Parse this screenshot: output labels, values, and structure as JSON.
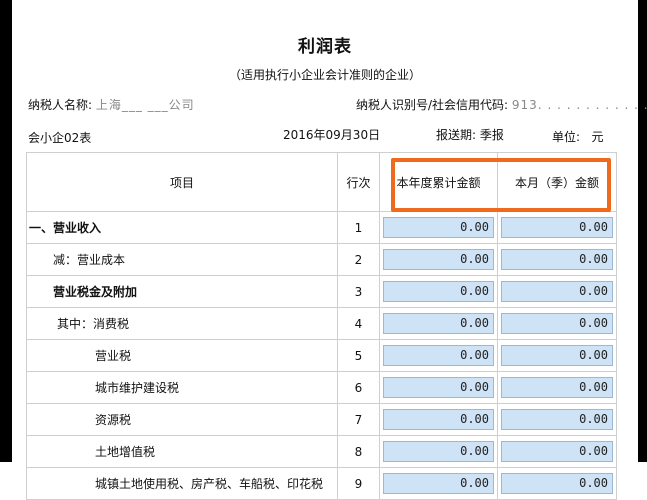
{
  "title": "利润表",
  "subtitle": "（适用执行小企业会计准则的企业）",
  "taxpayer": {
    "name_label": "纳税人名称: ",
    "name_value": "上海___ ___公司",
    "id_label": "纳税人识别号/社会信用代码: ",
    "id_value": "913. . . . . . . . . . . . . . ."
  },
  "form_code": "会小企02表",
  "report_date": "2016年09月30日",
  "period_label": "报送期: ",
  "period_value": "季报",
  "unit_label": "单位:",
  "unit_value": "元",
  "table": {
    "headers": {
      "item": "项目",
      "line": "行次",
      "ytd": "本年度累计金额",
      "period": "本月（季）金额"
    },
    "rows": [
      {
        "item": "一、营业收入",
        "line": "1",
        "ytd": "0.00",
        "period": "0.00"
      },
      {
        "item": "减：营业成本",
        "line": "2",
        "ytd": "0.00",
        "period": "0.00"
      },
      {
        "item": "营业税金及附加",
        "line": "3",
        "ytd": "0.00",
        "period": "0.00"
      },
      {
        "item": "其中：消费税",
        "line": "4",
        "ytd": "0.00",
        "period": "0.00"
      },
      {
        "item": "营业税",
        "line": "5",
        "ytd": "0.00",
        "period": "0.00"
      },
      {
        "item": "城市维护建设税",
        "line": "6",
        "ytd": "0.00",
        "period": "0.00"
      },
      {
        "item": "资源税",
        "line": "7",
        "ytd": "0.00",
        "period": "0.00"
      },
      {
        "item": "土地增值税",
        "line": "8",
        "ytd": "0.00",
        "period": "0.00"
      },
      {
        "item": "城镇土地使用税、房产税、车船税、印花税",
        "line": "9",
        "ytd": "0.00",
        "period": "0.00"
      }
    ]
  },
  "colors": {
    "highlight": "#f06a1d",
    "input_bg": "#cfe3f7"
  }
}
